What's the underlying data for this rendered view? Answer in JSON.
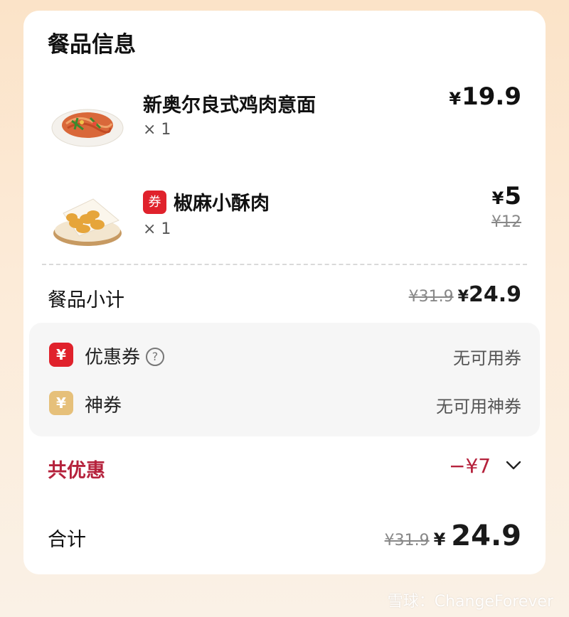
{
  "section_title": "餐品信息",
  "items": [
    {
      "name": "新奥尔良式鸡肉意面",
      "qty": "× 1",
      "price": "19.9",
      "currency": "¥"
    },
    {
      "name": "椒麻小酥肉",
      "qty": "× 1",
      "price": "5",
      "currency": "¥",
      "original_price": "¥12",
      "tag": "券"
    }
  ],
  "subtotal": {
    "label": "餐品小计",
    "original": "¥31.9",
    "currency": "¥",
    "amount": "24.9"
  },
  "discounts": [
    {
      "icon": "¥",
      "label": "优惠券",
      "help": "?",
      "value": "无可用券",
      "color": "#e0222c"
    },
    {
      "icon": "¥",
      "label": "神券",
      "value": "无可用神券",
      "color": "#e6c07a"
    }
  ],
  "total_discount": {
    "label": "共优惠",
    "value": "−¥7"
  },
  "total": {
    "label": "合计",
    "original": "¥31.9",
    "currency": "¥",
    "amount": "24.9"
  },
  "watermark": "雪球：ChangeForever",
  "colors": {
    "accent_red": "#b5223c",
    "tag_red": "#e0222c",
    "gold": "#e6c07a"
  }
}
